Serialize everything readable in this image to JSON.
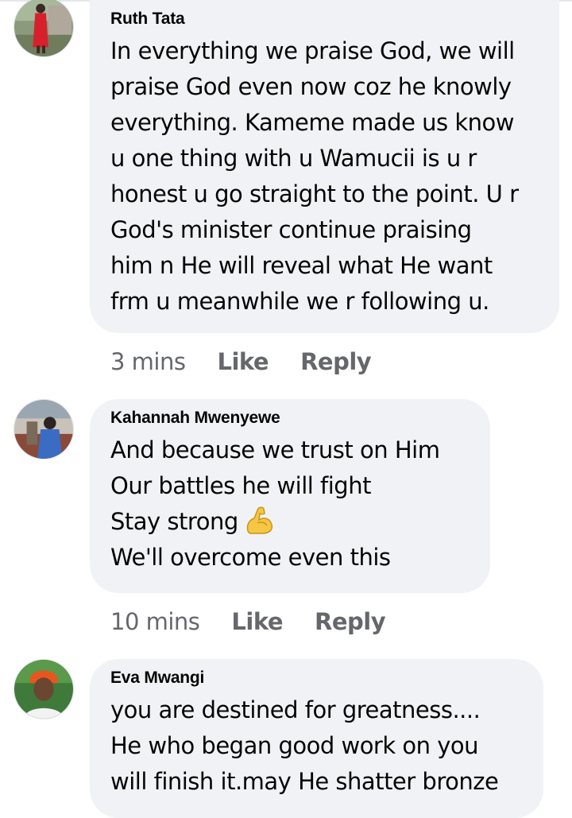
{
  "comments": [
    {
      "author": "Ruth Tata",
      "lines": [
        "In everything we praise God, we will",
        "praise God even now coz he knowly",
        "everything. Kameme made us know",
        "u one thing with u Wamucii is u r",
        "honest u go straight to the point. U r",
        "God's minister continue praising",
        "him n He will reveal what He want",
        "frm u meanwhile we r following u."
      ],
      "time": "3 mins",
      "like_label": "Like",
      "reply_label": "Reply"
    },
    {
      "author": "Kahannah Mwenyewe",
      "lines": [
        "And because we trust on Him",
        "Our battles he will fight",
        "Stay strong",
        "We'll overcome even this"
      ],
      "emoji": "flexed-biceps-icon",
      "time": "10 mins",
      "like_label": "Like",
      "reply_label": "Reply"
    },
    {
      "author": "Eva Mwangi",
      "lines": [
        "you are destined for greatness....",
        "He who began good work on you",
        "will finish it.may He shatter bronze"
      ]
    }
  ],
  "colors": {
    "bubble": "#f0f2f5",
    "meta_text": "#65676b",
    "body_text": "#050505"
  }
}
